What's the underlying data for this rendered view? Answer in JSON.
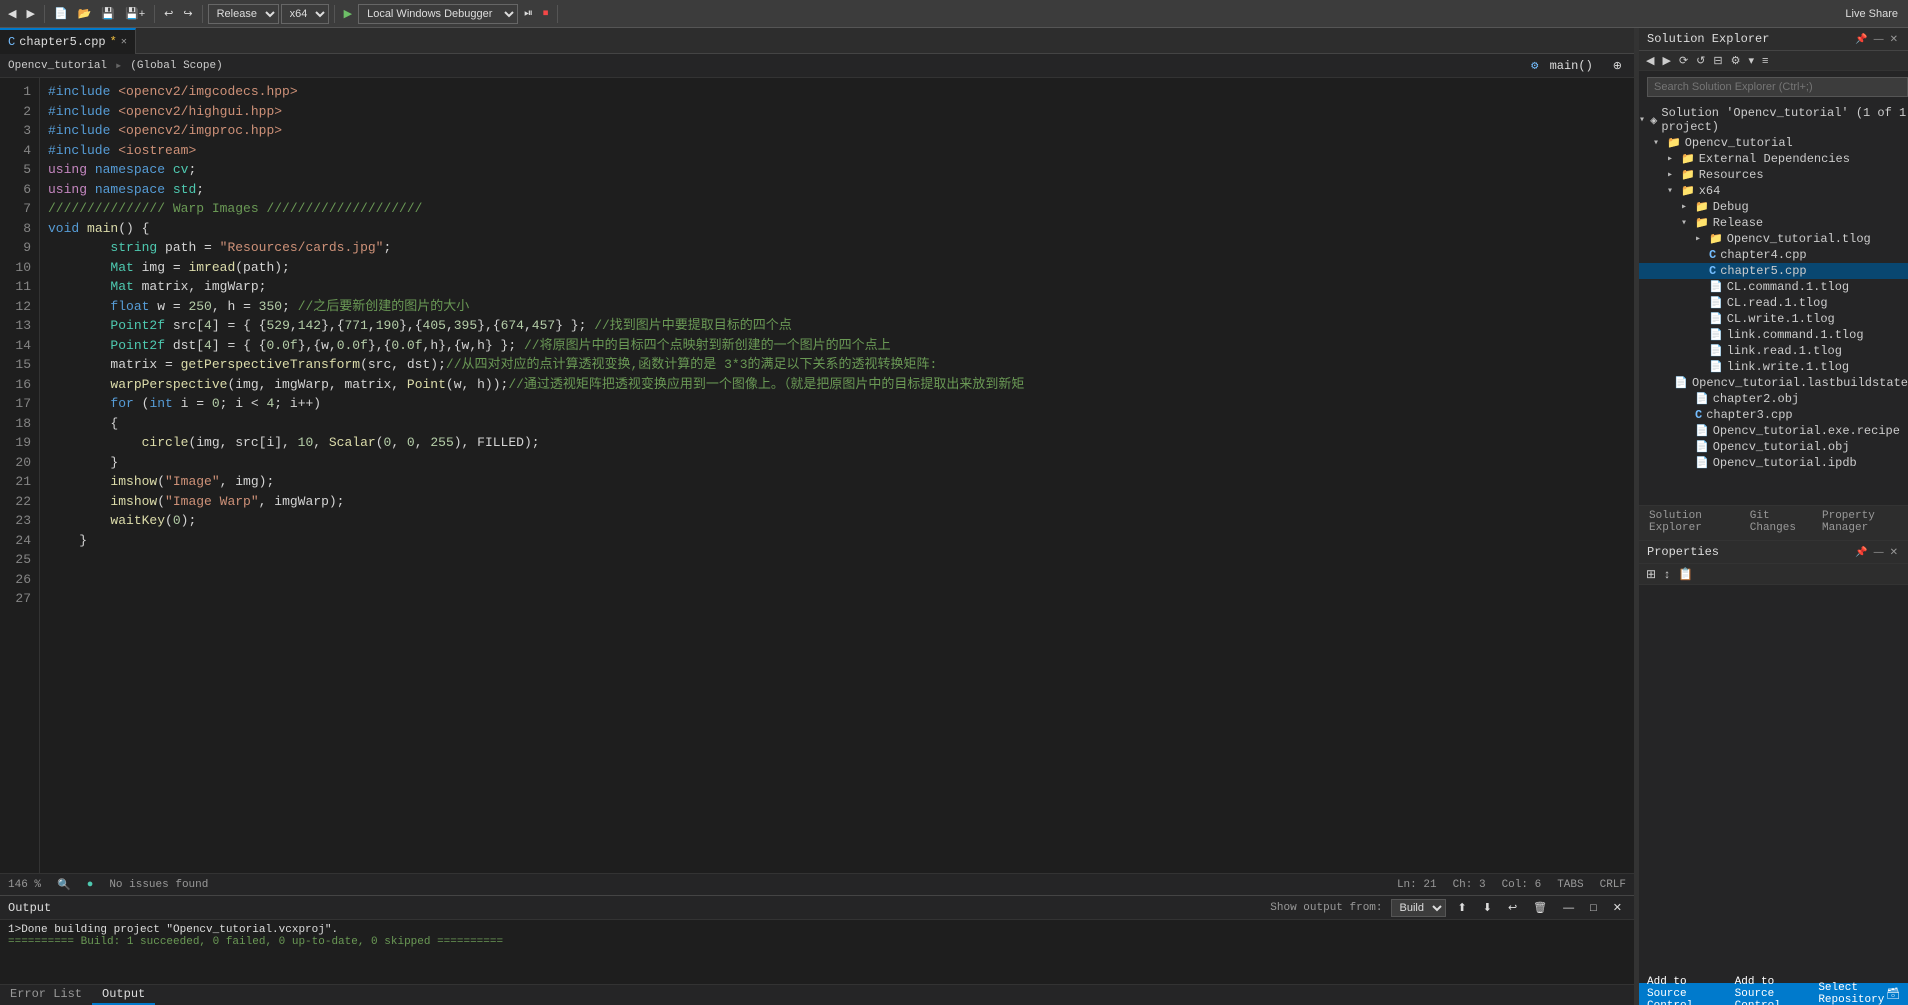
{
  "toolbar": {
    "config_label": "Release",
    "platform_label": "x64",
    "debugger_label": "Local Windows Debugger",
    "live_share_label": "Live Share"
  },
  "editor": {
    "tab_label": "chapter5.cpp",
    "tab_modified": true,
    "breadcrumb_project": "Opencv_tutorial",
    "breadcrumb_scope": "(Global Scope)",
    "breadcrumb_func": "main()",
    "code_lines": [
      {
        "num": 1,
        "tokens": [
          {
            "t": "kw",
            "v": "#include"
          },
          {
            "t": "op",
            "v": " "
          },
          {
            "t": "inc",
            "v": "<opencv2/imgcodecs.hpp>"
          }
        ]
      },
      {
        "num": 2,
        "tokens": [
          {
            "t": "kw",
            "v": "#include"
          },
          {
            "t": "op",
            "v": " "
          },
          {
            "t": "inc",
            "v": "<opencv2/highgui.hpp>"
          }
        ]
      },
      {
        "num": 3,
        "tokens": [
          {
            "t": "kw",
            "v": "#include"
          },
          {
            "t": "op",
            "v": " "
          },
          {
            "t": "inc",
            "v": "<opencv2/imgproc.hpp>"
          }
        ]
      },
      {
        "num": 4,
        "tokens": [
          {
            "t": "kw",
            "v": "#include"
          },
          {
            "t": "op",
            "v": " "
          },
          {
            "t": "inc",
            "v": "<iostream>"
          }
        ]
      },
      {
        "num": 5,
        "tokens": [
          {
            "t": "kw2",
            "v": "using"
          },
          {
            "t": "op",
            "v": " "
          },
          {
            "t": "kw",
            "v": "namespace"
          },
          {
            "t": "op",
            "v": " "
          },
          {
            "t": "cn",
            "v": "cv"
          },
          {
            "t": "op",
            "v": ";"
          }
        ]
      },
      {
        "num": 6,
        "tokens": [
          {
            "t": "kw2",
            "v": "using"
          },
          {
            "t": "op",
            "v": " "
          },
          {
            "t": "kw",
            "v": "namespace"
          },
          {
            "t": "op",
            "v": " "
          },
          {
            "t": "cn",
            "v": "std"
          },
          {
            "t": "op",
            "v": ";"
          }
        ]
      },
      {
        "num": 7,
        "tokens": [
          {
            "t": "comment",
            "v": "/////////////// Warp Images ////////////////////"
          }
        ]
      },
      {
        "num": 8,
        "tokens": [
          {
            "t": "kw",
            "v": "void"
          },
          {
            "t": "op",
            "v": " "
          },
          {
            "t": "func",
            "v": "main"
          },
          {
            "t": "op",
            "v": "() {"
          }
        ]
      },
      {
        "num": 9,
        "tokens": [
          {
            "t": "op",
            "v": "        "
          },
          {
            "t": "type",
            "v": "string"
          },
          {
            "t": "op",
            "v": " path = "
          },
          {
            "t": "str",
            "v": "\"Resources/cards.jpg\""
          },
          {
            "t": "op",
            "v": ";"
          }
        ]
      },
      {
        "num": 10,
        "tokens": [
          {
            "t": "op",
            "v": "        "
          },
          {
            "t": "type",
            "v": "Mat"
          },
          {
            "t": "op",
            "v": " img = "
          },
          {
            "t": "func",
            "v": "imread"
          },
          {
            "t": "op",
            "v": "(path);"
          }
        ]
      },
      {
        "num": 11,
        "tokens": [
          {
            "t": "op",
            "v": "        "
          },
          {
            "t": "type",
            "v": "Mat"
          },
          {
            "t": "op",
            "v": " matrix, imgWarp;"
          }
        ]
      },
      {
        "num": 12,
        "tokens": [
          {
            "t": "op",
            "v": "        "
          },
          {
            "t": "kw",
            "v": "float"
          },
          {
            "t": "op",
            "v": " w = "
          },
          {
            "t": "num",
            "v": "250"
          },
          {
            "t": "op",
            "v": ", h = "
          },
          {
            "t": "num",
            "v": "350"
          },
          {
            "t": "op",
            "v": "; "
          },
          {
            "t": "comment",
            "v": "//之后要新创建的图片的大小"
          }
        ]
      },
      {
        "num": 13,
        "tokens": [
          {
            "t": "op",
            "v": "        "
          },
          {
            "t": "type",
            "v": "Point2f"
          },
          {
            "t": "op",
            "v": " src["
          },
          {
            "t": "num",
            "v": "4"
          },
          {
            "t": "op",
            "v": "] = { {"
          },
          {
            "t": "num",
            "v": "529"
          },
          {
            "t": "op",
            "v": ","
          },
          {
            "t": "num",
            "v": "142"
          },
          {
            "t": "op",
            "v": "},{"
          },
          {
            "t": "num",
            "v": "771"
          },
          {
            "t": "op",
            "v": ","
          },
          {
            "t": "num",
            "v": "190"
          },
          {
            "t": "op",
            "v": "},{"
          },
          {
            "t": "num",
            "v": "405"
          },
          {
            "t": "op",
            "v": ","
          },
          {
            "t": "num",
            "v": "395"
          },
          {
            "t": "op",
            "v": "},{"
          },
          {
            "t": "num",
            "v": "674"
          },
          {
            "t": "op",
            "v": ","
          },
          {
            "t": "num",
            "v": "457"
          },
          {
            "t": "op",
            "v": "} }; "
          },
          {
            "t": "comment",
            "v": "//找到图片中要提取目标的四个点"
          }
        ]
      },
      {
        "num": 14,
        "tokens": [
          {
            "t": "op",
            "v": "        "
          },
          {
            "t": "type",
            "v": "Point2f"
          },
          {
            "t": "op",
            "v": " dst["
          },
          {
            "t": "num",
            "v": "4"
          },
          {
            "t": "op",
            "v": "] = { {"
          },
          {
            "t": "num",
            "v": "0.0f"
          },
          {
            "t": "op",
            "v": "},{w,"
          },
          {
            "t": "num",
            "v": "0.0f"
          },
          {
            "t": "op",
            "v": "},{"
          },
          {
            "t": "num",
            "v": "0.0f"
          },
          {
            "t": "op",
            "v": ",h},{w,h} }; "
          },
          {
            "t": "comment",
            "v": "//将原图片中的目标四个点映射到新创建的一个图片的四个点上"
          }
        ]
      },
      {
        "num": 15,
        "tokens": [
          {
            "t": "op",
            "v": "        matrix = "
          },
          {
            "t": "func",
            "v": "getPerspectiveTransform"
          },
          {
            "t": "op",
            "v": "(src, dst);"
          },
          {
            "t": "comment",
            "v": "//从四对对应的点计算透视变换,函数计算的是 3*3的满足以下关系的透视转换矩阵:"
          }
        ]
      },
      {
        "num": 16,
        "tokens": [
          {
            "t": "op",
            "v": "        "
          },
          {
            "t": "func",
            "v": "warpPerspective"
          },
          {
            "t": "op",
            "v": "(img, imgWarp, matrix, "
          },
          {
            "t": "func",
            "v": "Point"
          },
          {
            "t": "op",
            "v": "(w, h));"
          },
          {
            "t": "comment",
            "v": "//通过透视矩阵把透视变换应用到一个图像上。（就是把原图片中的目标提取出来放到新矩"
          }
        ]
      },
      {
        "num": 17,
        "tokens": [
          {
            "t": "op",
            "v": ""
          }
        ]
      },
      {
        "num": 18,
        "tokens": [
          {
            "t": "op",
            "v": "        "
          },
          {
            "t": "kw",
            "v": "for"
          },
          {
            "t": "op",
            "v": " ("
          },
          {
            "t": "kw",
            "v": "int"
          },
          {
            "t": "op",
            "v": " i = "
          },
          {
            "t": "num",
            "v": "0"
          },
          {
            "t": "op",
            "v": "; i < "
          },
          {
            "t": "num",
            "v": "4"
          },
          {
            "t": "op",
            "v": "; i++)"
          }
        ]
      },
      {
        "num": 19,
        "tokens": [
          {
            "t": "op",
            "v": "        {"
          }
        ]
      },
      {
        "num": 20,
        "tokens": [
          {
            "t": "op",
            "v": "            "
          },
          {
            "t": "func",
            "v": "circle"
          },
          {
            "t": "op",
            "v": "(img, src[i], "
          },
          {
            "t": "num",
            "v": "10"
          },
          {
            "t": "op",
            "v": ", "
          },
          {
            "t": "func",
            "v": "Scalar"
          },
          {
            "t": "op",
            "v": "("
          },
          {
            "t": "num",
            "v": "0"
          },
          {
            "t": "op",
            "v": ", "
          },
          {
            "t": "num",
            "v": "0"
          },
          {
            "t": "op",
            "v": ", "
          },
          {
            "t": "num",
            "v": "255"
          },
          {
            "t": "op",
            "v": "), FILLED);"
          }
        ]
      },
      {
        "num": 21,
        "tokens": [
          {
            "t": "op",
            "v": "        }"
          }
        ]
      },
      {
        "num": 22,
        "tokens": [
          {
            "t": "op",
            "v": ""
          }
        ]
      },
      {
        "num": 23,
        "tokens": [
          {
            "t": "op",
            "v": "        "
          },
          {
            "t": "func",
            "v": "imshow"
          },
          {
            "t": "op",
            "v": "("
          },
          {
            "t": "str",
            "v": "\"Image\""
          },
          {
            "t": "op",
            "v": ", img);"
          }
        ]
      },
      {
        "num": 24,
        "tokens": [
          {
            "t": "op",
            "v": "        "
          },
          {
            "t": "func",
            "v": "imshow"
          },
          {
            "t": "op",
            "v": "("
          },
          {
            "t": "str",
            "v": "\"Image Warp\""
          },
          {
            "t": "op",
            "v": ", imgWarp);"
          }
        ]
      },
      {
        "num": 25,
        "tokens": [
          {
            "t": "op",
            "v": "        "
          },
          {
            "t": "func",
            "v": "waitKey"
          },
          {
            "t": "op",
            "v": "("
          },
          {
            "t": "num",
            "v": "0"
          },
          {
            "t": "op",
            "v": ");"
          }
        ]
      },
      {
        "num": 26,
        "tokens": [
          {
            "t": "op",
            "v": ""
          }
        ]
      },
      {
        "num": 27,
        "tokens": [
          {
            "t": "op",
            "v": "    }"
          }
        ]
      }
    ],
    "status": {
      "zoom": "146 %",
      "issues": "No issues found",
      "ln": "Ln: 21",
      "ch": "Ch: 3",
      "col": "Col: 6",
      "tabs": "TABS",
      "crlf": "CRLF"
    }
  },
  "solution_explorer": {
    "title": "Solution Explorer",
    "search_placeholder": "Search Solution Explorer (Ctrl+;)",
    "tree": [
      {
        "id": "sol",
        "label": "Solution 'Opencv_tutorial' (1 of 1 project)",
        "indent": 0,
        "type": "solution",
        "expanded": true
      },
      {
        "id": "proj",
        "label": "Opencv_tutorial",
        "indent": 1,
        "type": "folder",
        "expanded": true
      },
      {
        "id": "ext-dep",
        "label": "External Dependencies",
        "indent": 2,
        "type": "folder",
        "expanded": false
      },
      {
        "id": "resources",
        "label": "Resources",
        "indent": 2,
        "type": "folder",
        "expanded": false
      },
      {
        "id": "x64",
        "label": "x64",
        "indent": 2,
        "type": "folder",
        "expanded": true
      },
      {
        "id": "debug",
        "label": "Debug",
        "indent": 3,
        "type": "folder",
        "expanded": false
      },
      {
        "id": "release",
        "label": "Release",
        "indent": 3,
        "type": "folder",
        "expanded": true
      },
      {
        "id": "tlog-main",
        "label": "Opencv_tutorial.tlog",
        "indent": 4,
        "type": "folder",
        "expanded": false
      },
      {
        "id": "chapter4",
        "label": "chapter4.cpp",
        "indent": 4,
        "type": "cpp",
        "expanded": false
      },
      {
        "id": "chapter5",
        "label": "chapter5.cpp",
        "indent": 4,
        "type": "cpp",
        "selected": true
      },
      {
        "id": "cl-cmd",
        "label": "CL.command.1.tlog",
        "indent": 4,
        "type": "tlog"
      },
      {
        "id": "cl-read",
        "label": "CL.read.1.tlog",
        "indent": 4,
        "type": "tlog"
      },
      {
        "id": "cl-write",
        "label": "CL.write.1.tlog",
        "indent": 4,
        "type": "tlog"
      },
      {
        "id": "link-cmd",
        "label": "link.command.1.tlog",
        "indent": 4,
        "type": "tlog"
      },
      {
        "id": "link-read",
        "label": "link.read.1.tlog",
        "indent": 4,
        "type": "tlog"
      },
      {
        "id": "link-write",
        "label": "link.write.1.tlog",
        "indent": 4,
        "type": "tlog"
      },
      {
        "id": "lastbuild",
        "label": "Opencv_tutorial.lastbuildstate",
        "indent": 4,
        "type": "tlog"
      },
      {
        "id": "chapter2-obj",
        "label": "chapter2.obj",
        "indent": 3,
        "type": "file"
      },
      {
        "id": "chapter3-cpp",
        "label": "chapter3.cpp",
        "indent": 3,
        "type": "cpp"
      },
      {
        "id": "exe-recipe",
        "label": "Opencv_tutorial.exe.recipe",
        "indent": 3,
        "type": "file"
      },
      {
        "id": "obj",
        "label": "Opencv_tutorial.obj",
        "indent": 3,
        "type": "file"
      },
      {
        "id": "ipdb",
        "label": "Opencv_tutorial.ipdb",
        "indent": 3,
        "type": "file"
      }
    ]
  },
  "right_bottom_tabs": [
    {
      "id": "solution",
      "label": "Solution Explorer",
      "active": false
    },
    {
      "id": "git",
      "label": "Git Changes",
      "active": false
    },
    {
      "id": "property",
      "label": "Property Manager",
      "active": false
    }
  ],
  "properties": {
    "title": "Properties",
    "toolbar_buttons": [
      "grid-icon",
      "sort-icon",
      "property-pages-icon"
    ]
  },
  "output": {
    "title": "Output",
    "filter_label": "Build",
    "tabs": [
      {
        "id": "error-list",
        "label": "Error List",
        "active": false
      },
      {
        "id": "output",
        "label": "Output",
        "active": true
      }
    ],
    "lines": [
      "1>Done building project \"Opencv_tutorial.vcxproj\".",
      "========== Build: 1 succeeded, 0 failed, 0 up-to-date, 0 skipped =========="
    ]
  },
  "add_source_control": "Add to Source Control",
  "select_repository": "Select Repository"
}
